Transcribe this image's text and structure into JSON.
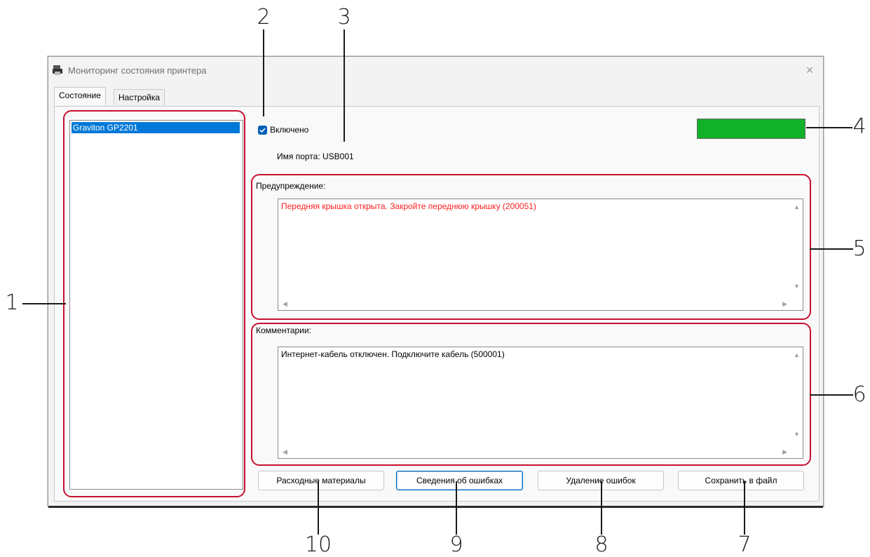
{
  "window": {
    "title": "Мониторинг состояния принтера",
    "app_icon": "printer-app-icon",
    "close_icon": "×"
  },
  "tabs": [
    {
      "label": "Состояние",
      "active": true
    },
    {
      "label": "Настройка",
      "active": false
    }
  ],
  "printer_list": {
    "items": [
      {
        "label": "Graviton GP2201",
        "selected": true
      }
    ]
  },
  "status": {
    "enabled_checkbox": {
      "label": "Включено",
      "checked": true
    },
    "port_name_label": "Имя порта: USB001",
    "indicator_color": "#11b12a"
  },
  "warning": {
    "label": "Предупреждение:",
    "text": "Передняя крышка открыта. Закройте переднюю крышку (200051)",
    "text_color": "#ff2020"
  },
  "comments": {
    "label": "Комментарии:",
    "text": "Интернет-кабель отключен. Подключите кабель (500001)"
  },
  "buttons": {
    "consumables": "Расходные материалы",
    "error_info": "Сведения об ошибках",
    "delete_errors": "Удаление ошибок",
    "save_to_file": "Сохранить в файл"
  },
  "scroll_arrows": {
    "up": "▲",
    "down": "▼",
    "left": "◀",
    "right": "▶"
  },
  "callouts": [
    "1",
    "2",
    "3",
    "4",
    "5",
    "6",
    "7",
    "8",
    "9",
    "10"
  ],
  "highlight_color": "#c8102e"
}
